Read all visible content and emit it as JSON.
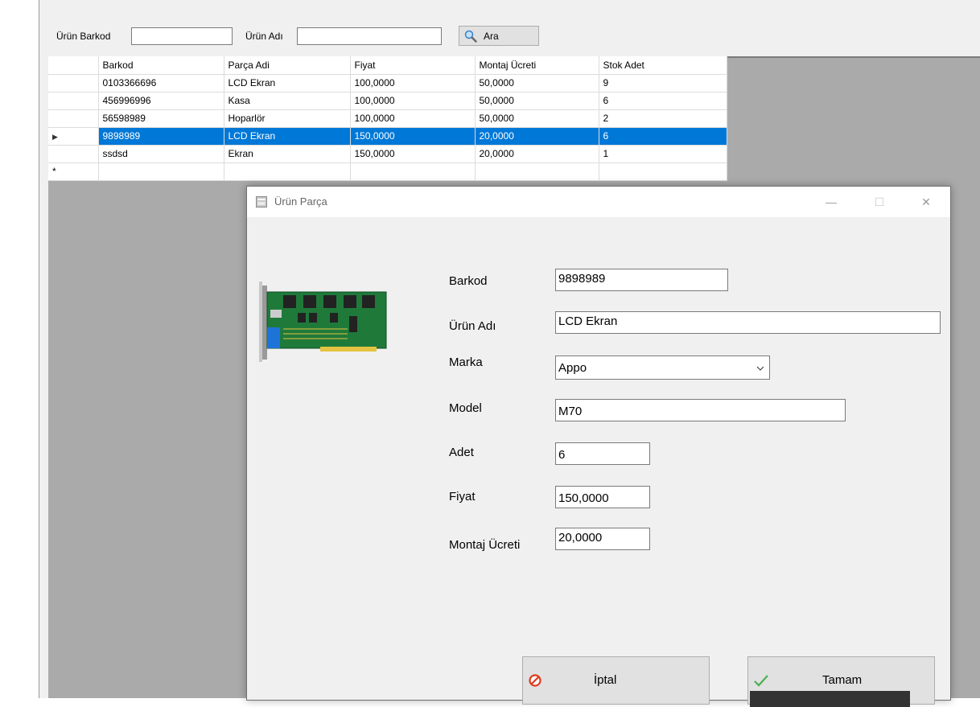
{
  "search": {
    "barkod_label": "Ürün Barkod",
    "barkod_value": "",
    "urun_adi_label": "Ürün Adı",
    "urun_adi_value": "",
    "button_label": "Ara",
    "button_icon": "search-icon"
  },
  "grid": {
    "columns": [
      "Barkod",
      "Parça Adi",
      "Fiyat",
      "Montaj Ücreti",
      "Stok Adet"
    ],
    "rows": [
      {
        "barkod": "0103366696",
        "parca": "LCD Ekran",
        "fiyat": "100,0000",
        "montaj": "50,0000",
        "stok": "9"
      },
      {
        "barkod": "456996996",
        "parca": "Kasa",
        "fiyat": "100,0000",
        "montaj": "50,0000",
        "stok": "6"
      },
      {
        "barkod": "56598989",
        "parca": "Hoparlör",
        "fiyat": "100,0000",
        "montaj": "50,0000",
        "stok": "2"
      },
      {
        "barkod": "9898989",
        "parca": "LCD Ekran",
        "fiyat": "150,0000",
        "montaj": "20,0000",
        "stok": "6"
      },
      {
        "barkod": "ssdsd",
        "parca": "Ekran",
        "fiyat": "150,0000",
        "montaj": "20,0000",
        "stok": "1"
      }
    ],
    "selected_row_index": 3,
    "selected_marker": "▶",
    "new_row_marker": "*",
    "selection_color": "#0078d7"
  },
  "dialog": {
    "title": "Ürün Parça",
    "minimize_glyph": "—",
    "maximize_glyph": "☐",
    "close_glyph": "✕",
    "image_icon": "expansion-card-icon",
    "fields": {
      "barkod_label": "Barkod",
      "barkod_value": "9898989",
      "urun_adi_label": "Ürün Adı",
      "urun_adi_value": "LCD Ekran",
      "marka_label": "Marka",
      "marka_value": "Appo",
      "model_label": "Model",
      "model_value": "M70",
      "adet_label": "Adet",
      "adet_value": "6",
      "fiyat_label": "Fiyat",
      "fiyat_value": "150,0000",
      "montaj_label": "Montaj Ücreti",
      "montaj_value": "20,0000"
    },
    "buttons": {
      "cancel_label": "İptal",
      "cancel_icon": "cancel-icon",
      "ok_label": "Tamam",
      "ok_icon": "checkmark-icon"
    }
  }
}
